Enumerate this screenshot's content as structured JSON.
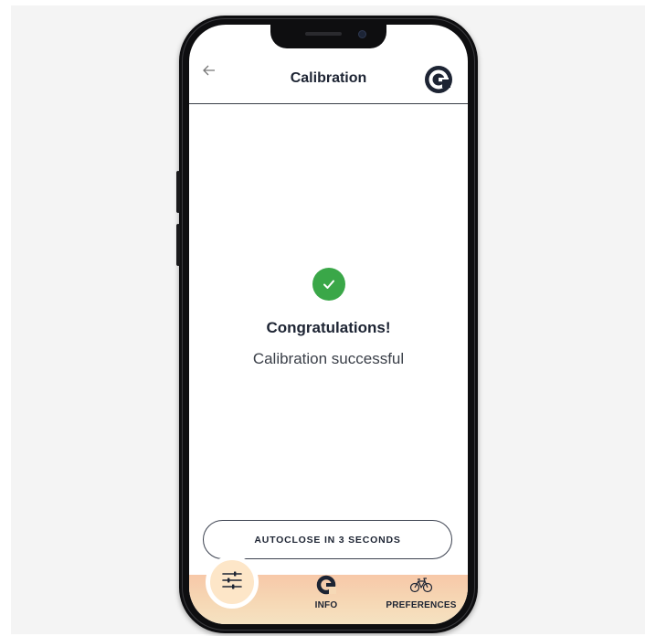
{
  "header": {
    "title": "Calibration",
    "back_icon": "arrow-left-icon",
    "brand_icon": "brand-c-logo-icon"
  },
  "result": {
    "icon": "check-circle-icon",
    "heading": "Congratulations!",
    "message": "Calibration successful"
  },
  "autoclose_button": {
    "label": "AUTOCLOSE IN 3 SECONDS"
  },
  "tabbar": {
    "tabs": [
      {
        "label": "",
        "icon": "sliders-icon",
        "active": true
      },
      {
        "label": "INFO",
        "icon": "brand-c-logo-icon",
        "active": false
      },
      {
        "label": "PREFERENCES",
        "icon": "bicycle-icon",
        "active": false
      }
    ]
  },
  "colors": {
    "brand": "#1d2433",
    "success": "#3aa748",
    "tabbar_gradient_start": "#f7c8a8",
    "tabbar_gradient_end": "#f5e2c2"
  }
}
